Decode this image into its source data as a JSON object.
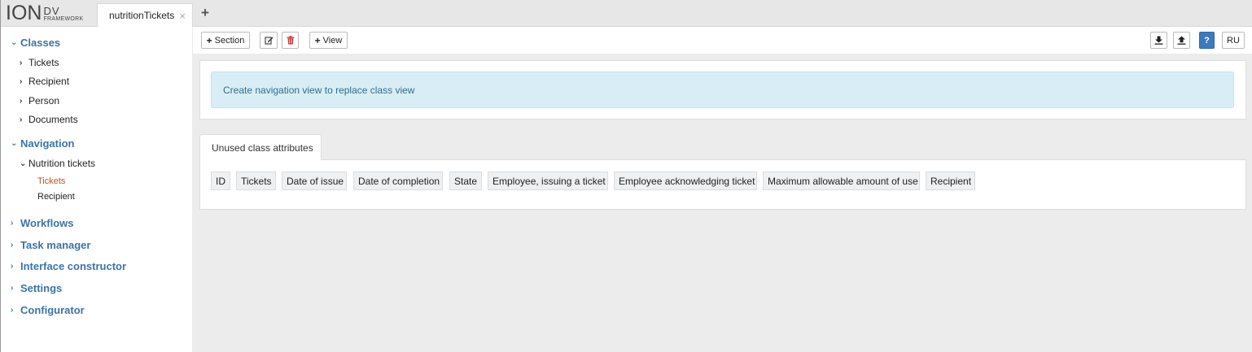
{
  "logo": {
    "ion": "ION",
    "dv": "DV",
    "framework": "FRAMEWORK"
  },
  "tabs": [
    {
      "label": "nutritionTickets",
      "close": "×"
    }
  ],
  "add_tab": "+",
  "sidebar": {
    "classes": {
      "label": "Classes",
      "items": [
        "Tickets",
        "Recipient",
        "Person",
        "Documents"
      ]
    },
    "navigation": {
      "label": "Navigation",
      "group": "Nutrition tickets",
      "subitems": [
        "Tickets",
        "Recipient"
      ]
    },
    "sections": [
      "Workflows",
      "Task manager",
      "Interface constructor",
      "Settings",
      "Configurator"
    ]
  },
  "toolbar": {
    "section_label": "Section",
    "view_label": "View",
    "help_label": "?",
    "lang_label": "RU"
  },
  "alert": {
    "text": "Create navigation view to replace class view"
  },
  "attributes": {
    "tab_label": "Unused class attributes",
    "items": [
      "ID",
      "Tickets",
      "Date of issue",
      "Date of completion",
      "State",
      "Employee, issuing a ticket",
      "Employee acknowledging ticket",
      "Maximum allowable amount of use",
      "Recipient"
    ]
  },
  "colors": {
    "accent": "#3a74a8",
    "active": "#c0571a",
    "alert_bg": "#d9edf6",
    "danger": "#c9302c"
  }
}
